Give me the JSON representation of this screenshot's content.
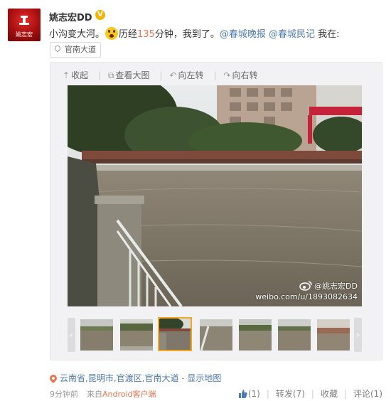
{
  "author": {
    "name": "姚志宏DD",
    "avatar_text": "姚志宏",
    "verified": true
  },
  "post": {
    "text_part1": "小沟变大河。",
    "emoji": "shocked-face",
    "text_part2": "历经",
    "highlight": "135",
    "text_part3": "分钟，我到了。",
    "mention1": "@春城晚报",
    "mention2": "@春城民记",
    "text_tail": " 我在:",
    "location_tag": "官南大道"
  },
  "toolbar": {
    "collapse": "收起",
    "view_large": "查看大图",
    "rotate_left": "向左转",
    "rotate_right": "向右转"
  },
  "image": {
    "watermark_name": "@姚志宏DD",
    "watermark_url": "weibo.com/u/1893082634"
  },
  "thumbnails": {
    "count": 7,
    "selected_index": 2
  },
  "geo": {
    "place": "云南省,昆明市,官渡区,官南大道",
    "separator": " - ",
    "show_map": "显示地图"
  },
  "meta": {
    "time": "9分钟前",
    "source_prefix": "来自",
    "source": "Android客户端"
  },
  "actions": {
    "like": "(1)",
    "repost": "转发(7)",
    "favorite": "收藏",
    "comment": "评论(1)"
  },
  "colors": {
    "accent": "#eb7350",
    "link": "#4d7ab0",
    "selected_thumb": "#f5a623"
  }
}
